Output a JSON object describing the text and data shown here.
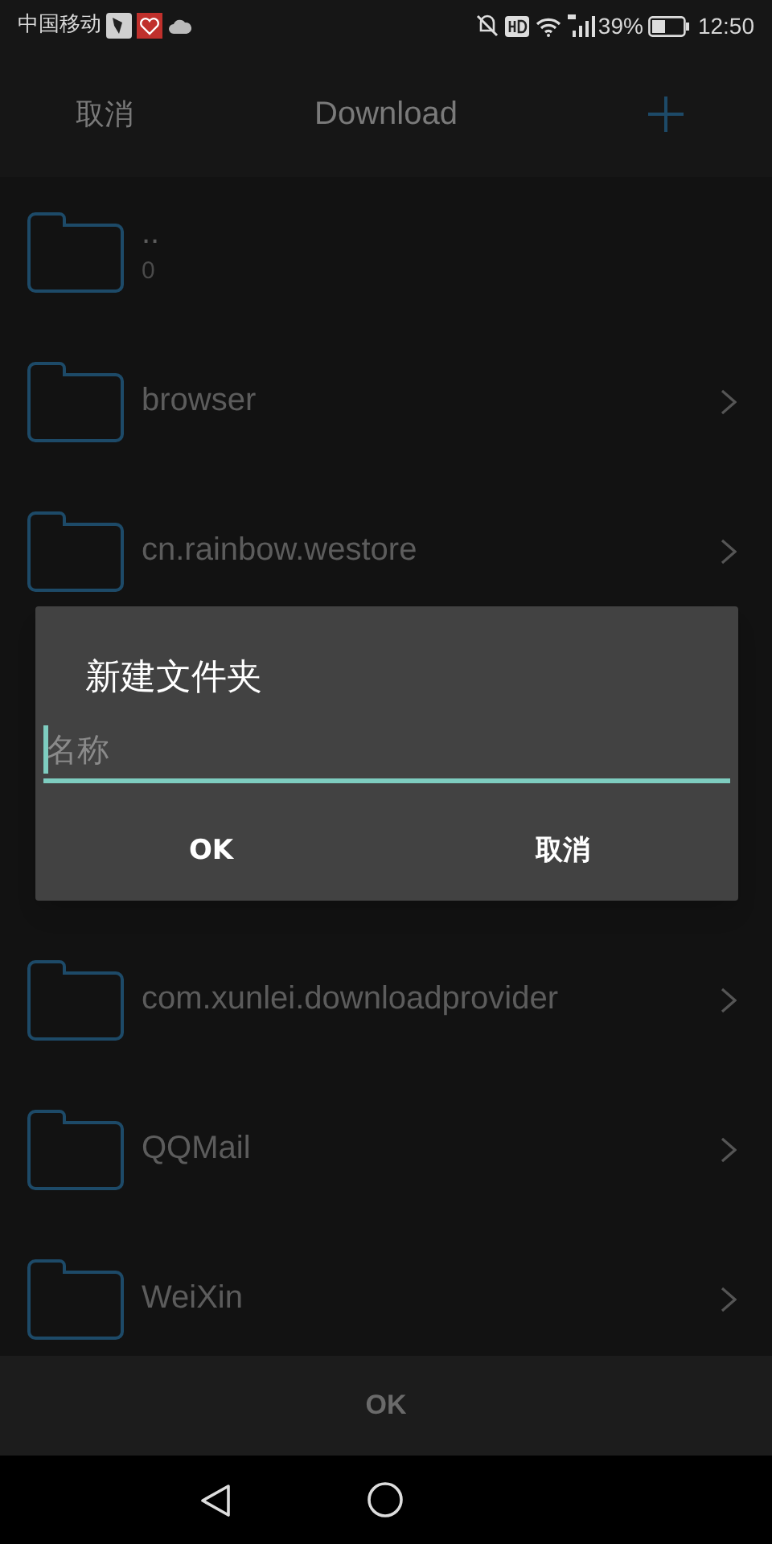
{
  "status_bar": {
    "carrier": "中国移动",
    "battery_text": "39%",
    "time": "12:50"
  },
  "header": {
    "cancel": "取消",
    "title": "Download"
  },
  "folders": [
    {
      "name": "..",
      "detail": "0",
      "kind": "parent"
    },
    {
      "name": "browser",
      "kind": "folder"
    },
    {
      "name": "cn.rainbow.westore",
      "kind": "folder"
    },
    {
      "kind": "covered"
    },
    {
      "name": "com.xunlei.downloadprovider",
      "kind": "folder"
    },
    {
      "name": "QQMail",
      "kind": "folder"
    },
    {
      "name": "WeiXin",
      "kind": "folder"
    }
  ],
  "dialog": {
    "title": "新建文件夹",
    "placeholder": "名称",
    "buttons": [
      "OK",
      "取消"
    ]
  },
  "bottom_button": "OK"
}
